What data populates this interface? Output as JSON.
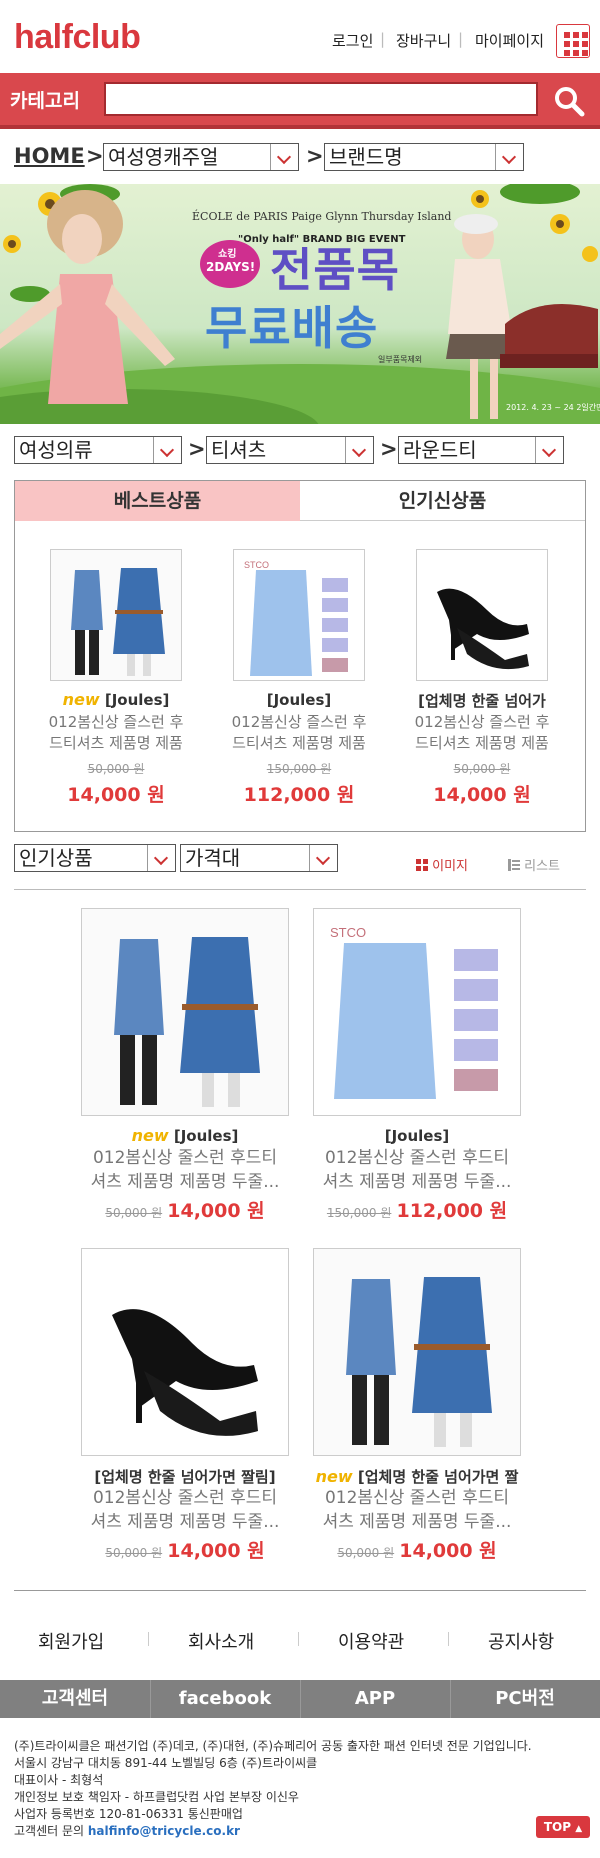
{
  "header": {
    "logo": "halfclub",
    "login": "로그인",
    "cart": "장바구니",
    "mypage": "마이페이지"
  },
  "search": {
    "category_label": "카테고리",
    "placeholder": ""
  },
  "breadcrumb": {
    "home": "HOME",
    "level1": "여성영캐주얼",
    "level2": "브랜드명"
  },
  "banner": {
    "brands": "ÉCOLE de PARIS   Paige Glynn   Thursday Island",
    "event": "\"Only half\" BRAND BIG EVENT",
    "badge_line1": "쇼킹",
    "badge_line2": "2DAYS!",
    "headline1": "전품목",
    "headline2": "무료배송",
    "note": "일부품목제외",
    "date": "2012. 4. 23 ~ 24  2일간만"
  },
  "filters": {
    "cat1": "여성의류",
    "cat2": "티셔츠",
    "cat3": "라운드티"
  },
  "tabs": {
    "best": "베스트상품",
    "new": "인기신상품"
  },
  "best_items": [
    {
      "new": "new",
      "brand": "[Joules]",
      "name1": "012봄신상 즐스런 후",
      "name2": "드티셔츠 제품명 제품",
      "original": "50,000 원",
      "price": "14,000 원"
    },
    {
      "new": "",
      "brand": "[Joules]",
      "name1": "012봄신상 즐스런 후",
      "name2": "드티셔츠 제품명 제품",
      "original": "150,000 원",
      "price": "112,000 원"
    },
    {
      "new": "",
      "brand": "[업체명 한줄 넘어가",
      "name1": "012봄신상 즐스런 후",
      "name2": "드티셔츠 제품명 제품",
      "original": "50,000 원",
      "price": "14,000 원"
    }
  ],
  "sort": {
    "sort1": "인기상품",
    "sort2": "가격대",
    "view_image": "이미지",
    "view_list": "리스트"
  },
  "grid_items": [
    {
      "new": "new",
      "brand": "[Joules]",
      "name1": "012봄신상 줄스런 후드티",
      "name2": "셔츠 제품명 제품명 두줄...",
      "original": "50,000 원",
      "price": "14,000 원"
    },
    {
      "new": "",
      "brand": "[Joules]",
      "name1": "012봄신상 줄스런 후드티",
      "name2": "셔츠 제품명 제품명 두줄...",
      "original": "150,000 원",
      "price": "112,000 원"
    },
    {
      "new": "",
      "brand": "[업체명 한줄 넘어가면 짤림]",
      "name1": "012봄신상 줄스런 후드티",
      "name2": "셔츠 제품명 제품명 두줄...",
      "original": "50,000 원",
      "price": "14,000 원"
    },
    {
      "new": "new",
      "brand": "[업체명 한줄 넘어가면 짤",
      "name1": "012봄신상 줄스런 후드티",
      "name2": "셔츠 제품명 제품명 두줄...",
      "original": "50,000 원",
      "price": "14,000 원"
    }
  ],
  "footer_nav": [
    "회원가입",
    "회사소개",
    "이용약관",
    "공지사항"
  ],
  "footer_bar": [
    "고객센터",
    "facebook",
    "APP",
    "PC버전"
  ],
  "footer_info": {
    "line1": "(주)트라이씨클은 패션기업 (주)데코, (주)대현, (주)슈페리어 공동 출자한 패션 인터넷 전문 기업입니다.",
    "line2": "서울시 강남구 대치동 891-44 노벨빌딩 6층 (주)트라이씨클",
    "line3": "대표이사 - 최형석",
    "line4": "개인정보 보호 책임자 - 하프클럽닷컴 사업 본부장 이신우",
    "line5": "사업자 등록번호 120-81-06331 통신판매업",
    "line6_prefix": "고객센터 문의 ",
    "email": "halfinfo@tricycle.co.kr",
    "top": "TOP"
  },
  "colors": {
    "brand": "#d9383e",
    "price": "#e03a3a",
    "new": "#f0b300",
    "tab_active": "#f9c4c4",
    "footer_bar": "#808080"
  }
}
